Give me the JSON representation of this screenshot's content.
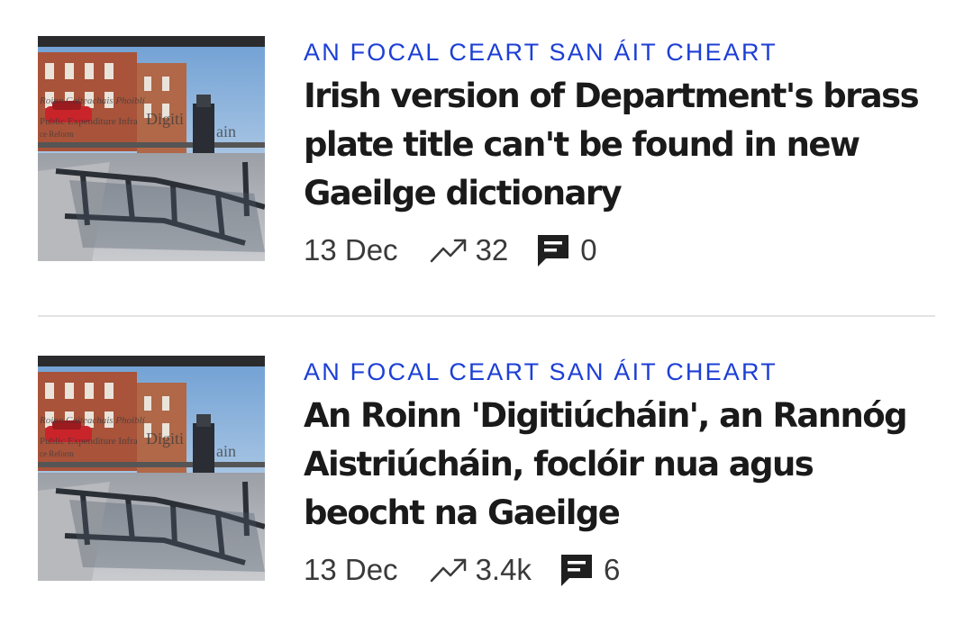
{
  "articles": [
    {
      "section": "AN FOCAL CEART SAN ÁIT CHEART",
      "title": "Irish version of Department's brass plate title can't be found in new Gaeilge dictionary",
      "date": "13 Dec",
      "views": "32",
      "comments": "0",
      "thumbnail": "street-photo-brass-plate",
      "thumbnail_text": [
        "Roinn Caiteachais Phoiblí",
        "Public Expenditure Infra",
        "ce Reform",
        "Digiti",
        "ain"
      ]
    },
    {
      "section": "AN FOCAL CEART SAN ÁIT CHEART",
      "title": "An Roinn 'Digitiúcháin', an Rannóg Aistriúcháin, foclóir nua agus beocht na Gaeilge",
      "date": "13 Dec",
      "views": "3.4k",
      "comments": "6",
      "thumbnail": "street-photo-brass-plate",
      "thumbnail_text": [
        "Roinn Caiteachais Phoiblí",
        "Public Expenditure Infra",
        "ce Reform",
        "Digiti",
        "ain"
      ]
    }
  ],
  "icons": {
    "trend": "trending-up-icon",
    "comment": "comment-icon"
  },
  "colors": {
    "section": "#1c3fd6",
    "title": "#1a1a1a",
    "meta": "#3a3a3a",
    "divider": "#e3e3e3"
  }
}
